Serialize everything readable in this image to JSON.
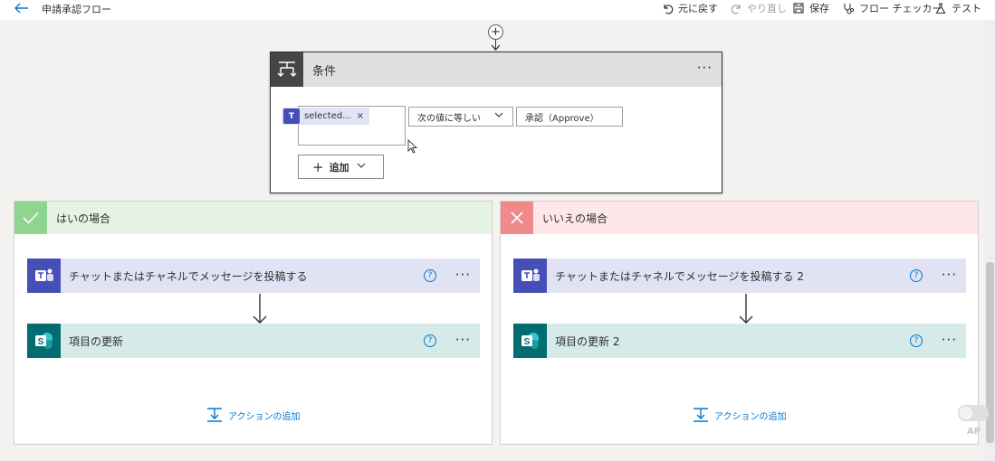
{
  "header": {
    "back_icon": "back-arrow-icon",
    "flow_title": "申請承認フロー",
    "undo_label": "元に戻す",
    "redo_label": "やり直し",
    "save_label": "保存",
    "checker_label": "フロー チェッカー",
    "test_label": "テスト"
  },
  "insert_step": {
    "icon": "plus-icon",
    "label": "+"
  },
  "condition": {
    "title": "条件",
    "more": "···",
    "token_label": "selected...",
    "token_remove": "×",
    "operator": "次の値に等しい",
    "value": "承認（Approve）",
    "add_label": "追加",
    "add_plus": "+",
    "chevron": "﹀"
  },
  "branches": {
    "yes": {
      "title": "はいの場合",
      "color": "#8fd48f",
      "teams_action": "チャットまたはチャネルでメッセージを投稿する",
      "sp_action": "項目の更新",
      "help": "?",
      "more": "···",
      "add_action": "アクションの追加"
    },
    "no": {
      "title": "いいえの場合",
      "color": "#ee8a8a",
      "teams_action": "チャットまたはチャネルでメッセージを投稿する 2",
      "sp_action": "項目の更新 2",
      "help": "?",
      "more": "···",
      "add_action": "アクションの追加"
    }
  },
  "overlay": {
    "ap_label": "AP"
  },
  "colors": {
    "accent": "#0078d4",
    "teams": "#464eb8",
    "sharepoint": "#036c70"
  }
}
